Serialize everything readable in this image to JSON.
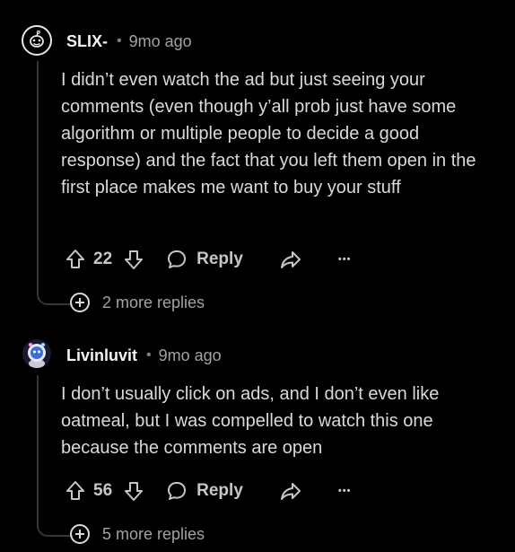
{
  "comments": [
    {
      "username": "SLIX-",
      "separator": "•",
      "time": "9mo ago",
      "text": "I didn’t even watch the ad but just seeing your comments (even though y’all prob just have some algorithm or multiple people to decide a good response) and the fact that you left them open in the first place makes me want to buy your stuff",
      "votes": "22",
      "reply_label": "Reply",
      "more_icon": "•••",
      "more_replies": "2 more replies",
      "avatar_icon": "snoo-outline-avatar-icon"
    },
    {
      "username": "Livinluvit",
      "separator": "•",
      "time": "9mo ago",
      "text": "I don’t usually click on ads, and I don’t even like oatmeal, but I was compelled to watch this one because the comments are open",
      "votes": "56",
      "reply_label": "Reply",
      "more_icon": "•••",
      "more_replies": "5 more replies",
      "avatar_icon": "snoo-astronaut-avatar-icon"
    }
  ],
  "colors": {
    "background": "#000000",
    "text": "#d7dadc",
    "muted": "#a0a3a5",
    "thread_line": "#343536"
  }
}
